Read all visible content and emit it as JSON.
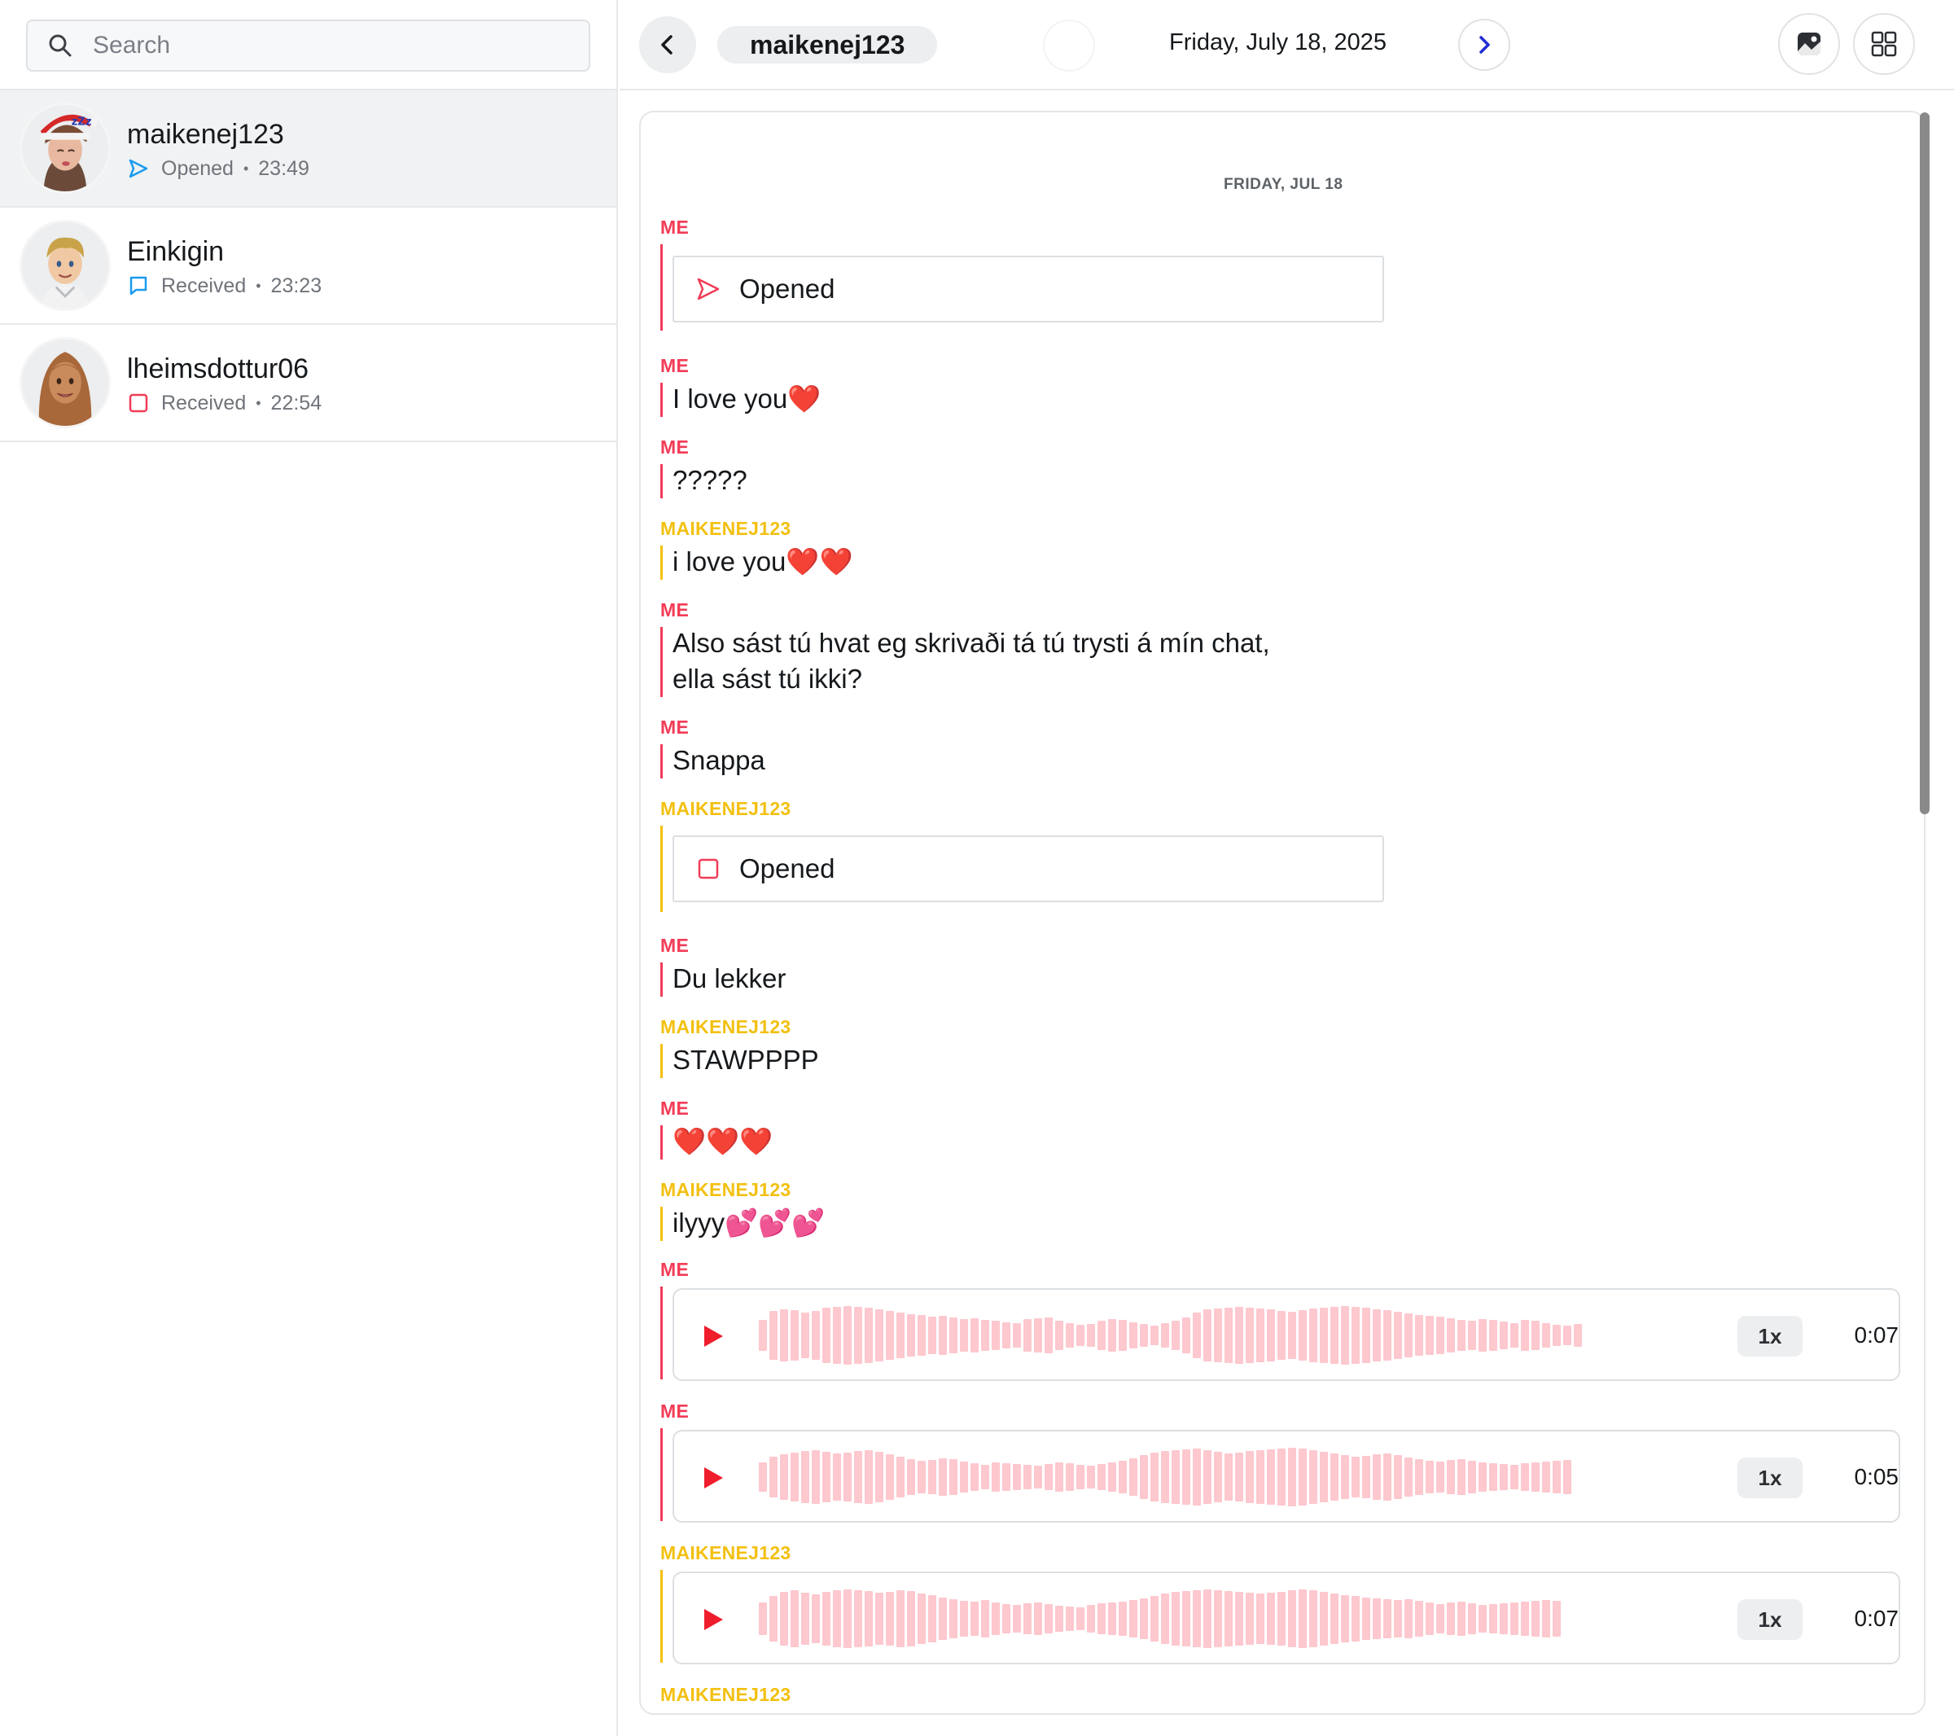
{
  "search": {
    "placeholder": "Search"
  },
  "conversations": [
    {
      "name": "maikenej123",
      "status": "Opened",
      "time": "23:49",
      "status_icon": "sent-arrow-icon",
      "status_color": "#1a9bf0"
    },
    {
      "name": "Einkigin",
      "status": "Received",
      "time": "23:23",
      "status_icon": "chat-bubble-icon",
      "status_color": "#1a9bf0"
    },
    {
      "name": "lheimsdottur06",
      "status": "Received",
      "time": "22:54",
      "status_icon": "snap-square-icon",
      "status_color": "#f23c57"
    }
  ],
  "header": {
    "contact": "maikenej123",
    "date": "Friday, July 18, 2025"
  },
  "chat": {
    "date_separator": "FRIDAY, JUL 18",
    "messages": [
      {
        "sender": "ME",
        "type": "snap",
        "status": "Opened"
      },
      {
        "sender": "ME",
        "type": "text",
        "text": "I love you❤️"
      },
      {
        "sender": "ME",
        "type": "text",
        "text": "?????"
      },
      {
        "sender": "MAIKENEJ123",
        "type": "text",
        "text": "i love you❤️❤️"
      },
      {
        "sender": "ME",
        "type": "text",
        "text": "Also sást tú hvat eg skrivaði tá tú trysti á mín chat,\nella sást tú ikki?"
      },
      {
        "sender": "ME",
        "type": "text",
        "text": "Snappa"
      },
      {
        "sender": "MAIKENEJ123",
        "type": "snap",
        "status": "Opened"
      },
      {
        "sender": "ME",
        "type": "text",
        "text": "Du lekker"
      },
      {
        "sender": "MAIKENEJ123",
        "type": "text",
        "text": "STAWPPPP"
      },
      {
        "sender": "ME",
        "type": "text",
        "text": "❤️❤️❤️"
      },
      {
        "sender": "MAIKENEJ123",
        "type": "text",
        "text": "ilyyy💕💕💕"
      },
      {
        "sender": "ME",
        "type": "audio",
        "speed": "1x",
        "duration": "0:07"
      },
      {
        "sender": "ME",
        "type": "audio",
        "speed": "1x",
        "duration": "0:05"
      },
      {
        "sender": "MAIKENEJ123",
        "type": "audio",
        "speed": "1x",
        "duration": "0:07"
      },
      {
        "sender": "MAIKENEJ123",
        "type": "partial"
      }
    ]
  },
  "colors": {
    "me": "#f23c57",
    "them": "#f3c010",
    "accent_blue": "#1a9bf0",
    "waveform": "#fdc8ce",
    "play": "#f01d2c"
  }
}
